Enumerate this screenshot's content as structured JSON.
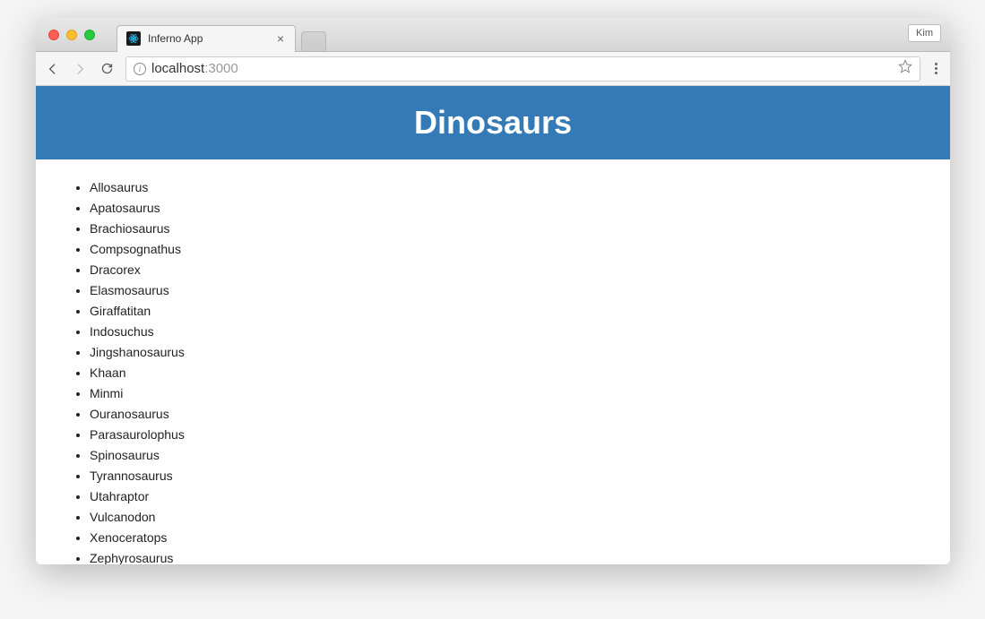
{
  "browser": {
    "tab_title": "Inferno App",
    "profile_name": "Kim",
    "url_host": "localhost",
    "url_port": ":3000"
  },
  "page": {
    "title": "Dinosaurs",
    "items": [
      "Allosaurus",
      "Apatosaurus",
      "Brachiosaurus",
      "Compsognathus",
      "Dracorex",
      "Elasmosaurus",
      "Giraffatitan",
      "Indosuchus",
      "Jingshanosaurus",
      "Khaan",
      "Minmi",
      "Ouranosaurus",
      "Parasaurolophus",
      "Spinosaurus",
      "Tyrannosaurus",
      "Utahraptor",
      "Vulcanodon",
      "Xenoceratops",
      "Zephyrosaurus"
    ]
  }
}
